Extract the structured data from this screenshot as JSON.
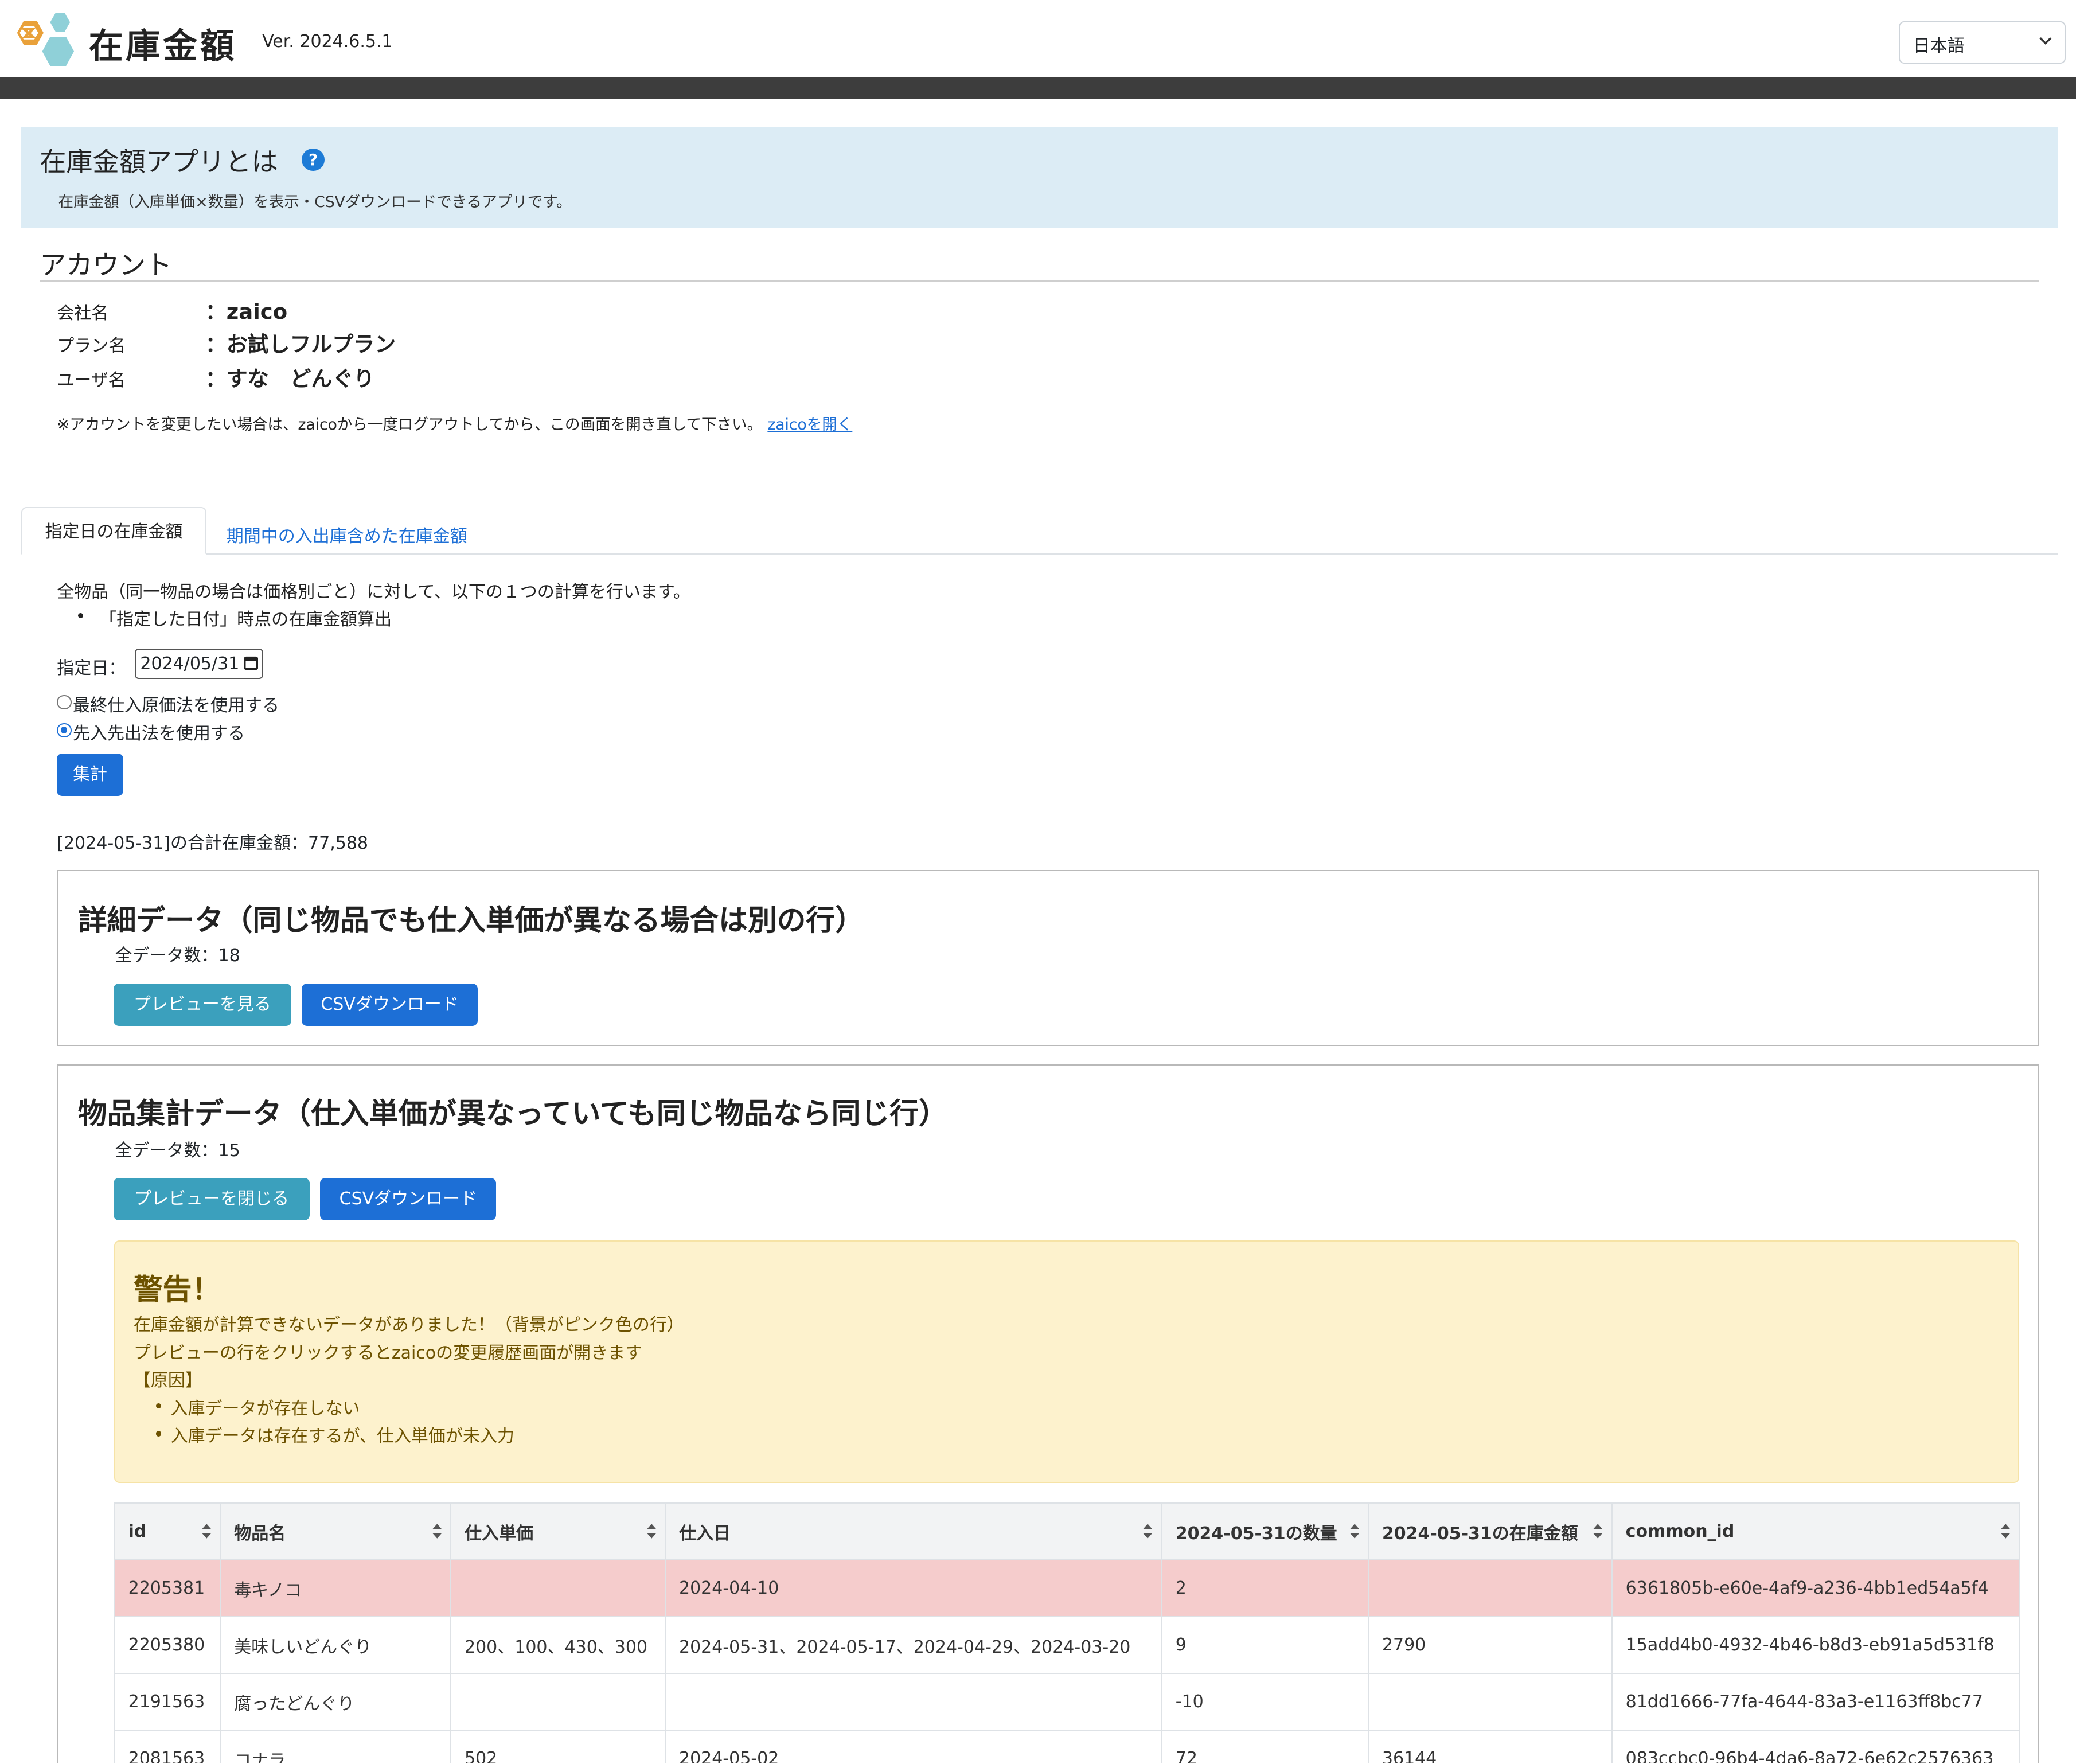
{
  "header": {
    "app_title": "在庫金額",
    "version": "Ver. 2024.6.5.1",
    "language": "日本語",
    "logo_icon": "hexagon-logo-icon"
  },
  "intro": {
    "title": "在庫金額アプリとは",
    "help_icon": "question-icon",
    "description": "在庫金額（入庫単価×数量）を表示・CSVダウンロードできるアプリです。"
  },
  "account": {
    "title": "アカウント",
    "rows": [
      {
        "label": "会社名",
        "value": "：zaico"
      },
      {
        "label": "プラン名",
        "value": "：お試しフルプラン"
      },
      {
        "label": "ユーザ名",
        "value": "：すな　どんぐり"
      }
    ],
    "note": "※アカウントを変更したい場合は、zaicoから一度ログアウトしてから、この画面を開き直して下さい。",
    "link": "zaicoを開く"
  },
  "tabs": {
    "active": "指定日の在庫金額",
    "other": "期間中の入出庫含めた在庫金額"
  },
  "form": {
    "desc": "全物品（同一物品の場合は価格別ごと）に対して、以下の１つの計算を行います。",
    "bullet": "「指定した日付」時点の在庫金額算出",
    "date_label": "指定日：",
    "date_value": "2024/05/31",
    "radio1": "最終仕入原価法を使用する",
    "radio2": "先入先出法を使用する",
    "submit": "集計",
    "total": "[2024-05-31]の合計在庫金額：77,588"
  },
  "detail_card": {
    "title": "詳細データ（同じ物品でも仕入単価が異なる場合は別の行）",
    "count": "全データ数：18",
    "preview_btn": "プレビューを見る",
    "csv_btn": "CSVダウンロード"
  },
  "summary_card": {
    "title": "物品集計データ（仕入単価が異なっていても同じ物品なら同じ行）",
    "count": "全データ数：15",
    "preview_btn": "プレビューを閉じる",
    "csv_btn": "CSVダウンロード"
  },
  "warning": {
    "title": "警告！",
    "line1": "在庫金額が計算できないデータがありました！（背景がピンク色の行）",
    "line2": "プレビューの行をクリックするとzaicoの変更履歴画面が開きます",
    "line3": "【原因】",
    "bullet1": "入庫データが存在しない",
    "bullet2": "入庫データは存在するが、仕入単価が未入力"
  },
  "table": {
    "headers": [
      "id",
      "物品名",
      "仕入単価",
      "仕入日",
      "2024-05-31の数量",
      "2024-05-31の在庫金額",
      "common_id"
    ],
    "rows": [
      [
        "2205381",
        "毒キノコ",
        "",
        "2024-04-10",
        "2",
        "",
        "6361805b-e60e-4af9-a236-4bb1ed54a5f4"
      ],
      [
        "2205380",
        "美味しいどんぐり",
        "200、100、430、300",
        "2024-05-31、2024-05-17、2024-04-29、2024-03-20",
        "9",
        "2790",
        "15add4b0-4932-4b46-b8d3-eb91a5d531f8"
      ],
      [
        "2191563",
        "腐ったどんぐり",
        "",
        "",
        "-10",
        "",
        "81dd1666-77fa-4644-83a3-e1163ff8bc77"
      ],
      [
        "2081563",
        "コナラ",
        "502",
        "2024-05-02",
        "72",
        "36144",
        "083ccbc0-96b4-4da6-8a72-6e62c2576363"
      ]
    ],
    "error_row_color": "#f5cccc"
  },
  "colors": {
    "primary": "#1d6fd6",
    "info": "#3ba0bd",
    "warning_bg": "#fdf2cd",
    "header_bar": "#3d3d3d"
  }
}
